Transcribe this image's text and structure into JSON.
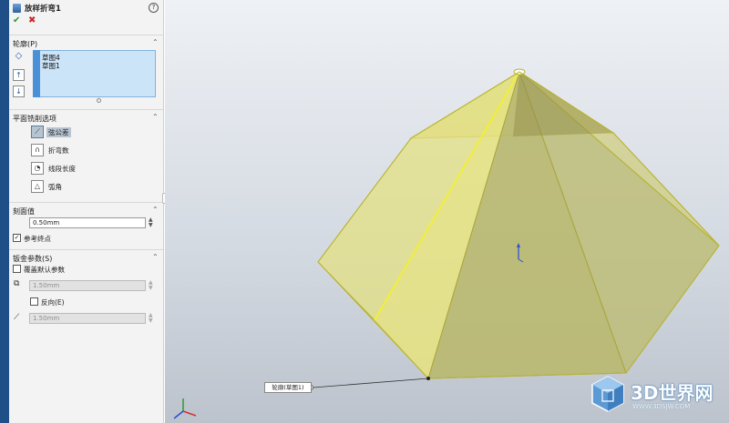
{
  "panel": {
    "title": "放样折弯1",
    "help_symbol": "?",
    "ok_symbol": "✔",
    "cancel_symbol": "✖"
  },
  "profiles": {
    "header": "轮廓(P)",
    "items": [
      "草图4",
      "草图1"
    ]
  },
  "faceting": {
    "header": "平面铣削选项",
    "options": [
      {
        "label": "弦公差",
        "selected": true,
        "icon": "chord-tolerance-icon"
      },
      {
        "label": "折弯数",
        "selected": false,
        "icon": "bend-count-icon"
      },
      {
        "label": "线段长度",
        "selected": false,
        "icon": "segment-length-icon"
      },
      {
        "label": "弧角",
        "selected": false,
        "icon": "arc-angle-icon"
      }
    ]
  },
  "chord": {
    "header": "刻面值",
    "value": "0.50mm",
    "ref_endpoint_label": "参考终点",
    "ref_endpoint_checked": true
  },
  "sheet_metal": {
    "header": "钣金参数(S)",
    "override_label": "覆盖默认参数",
    "override_checked": false,
    "thickness": "1.50mm",
    "reverse_label": "反向(E)",
    "reverse_checked": false,
    "radius": "1.50mm"
  },
  "viewport": {
    "callout": "轮廓(草图1)"
  },
  "watermark": {
    "brand": "3D世界网",
    "url": "WWW.3DSJW.COM"
  },
  "colors": {
    "accent": "#4a90d9",
    "selection": "#cce4f7",
    "part_fill": "#e6e37a",
    "part_edge": "#b8b431"
  }
}
